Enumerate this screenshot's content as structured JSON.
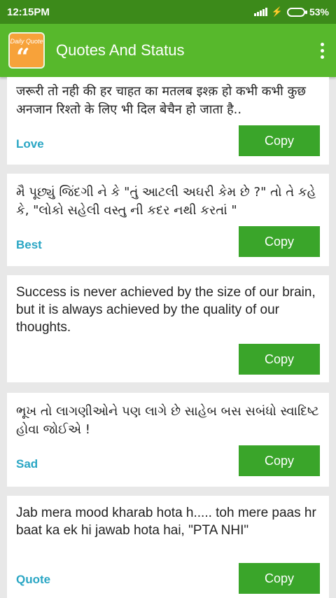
{
  "status_bar": {
    "time": "12:15PM",
    "battery": "53%",
    "signal_icon": "signal-icon",
    "charging_icon": "bolt-icon"
  },
  "app_bar": {
    "logo_text": "Daily Quote",
    "title": "Quotes And Status"
  },
  "cards": [
    {
      "text": "जरूरी तो नही की हर चाहत का मतलब इश्क़ हो कभी कभी कुछ अनजान रिश्तो के लिए भी दिल बेचैन हो जाता है..",
      "category": "Love",
      "copy_label": "Copy"
    },
    {
      "text": "મૈ પૂછ્યું જિંદગી ને કે \"તું આટલી અઘરી કેમ છે ?\" તો તે કહે કે, \"લોકો સહેલી વસ્તુ ની કદર નથી કરતાં \"",
      "category": "Best",
      "copy_label": "Copy"
    },
    {
      "text": "Success is never achieved by the size of our brain, but it is always achieved by the quality of our thoughts.",
      "category": "",
      "copy_label": "Copy"
    },
    {
      "text": "ભૂખ તો લાગણીઓને પણ લાગે છે સાહેબ બસ સબંધો સ્વાદિષ્ટ હોવા જોઈએ !",
      "category": "Sad",
      "copy_label": "Copy"
    },
    {
      "text": "Jab mera mood kharab hota h..... toh mere paas hr baat ka ek hi jawab hota hai, \"PTA NHI\"",
      "category": "Quote",
      "copy_label": "Copy"
    }
  ]
}
